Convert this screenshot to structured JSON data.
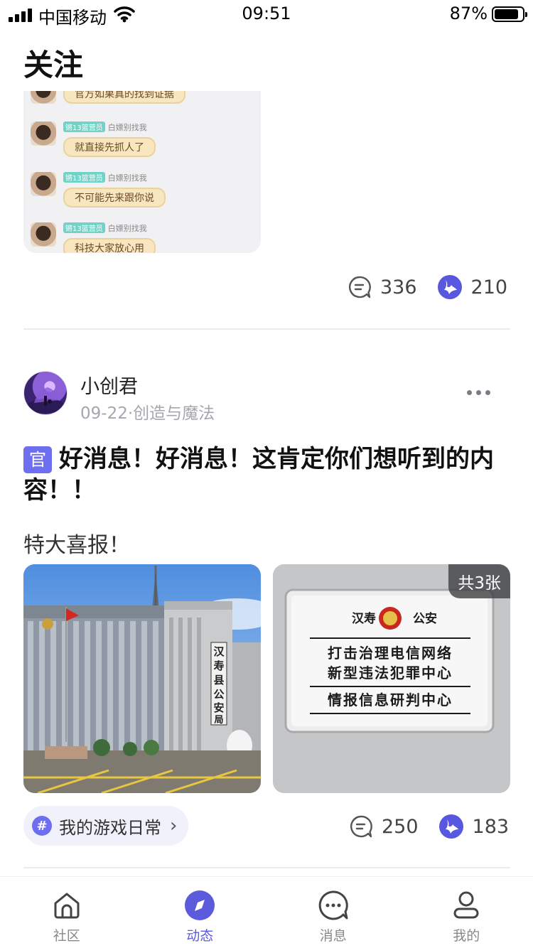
{
  "status_bar": {
    "carrier": "中国移动",
    "time": "09:51",
    "battery": "87%",
    "battery_level": 0.87,
    "signal_bars": 4
  },
  "page": {
    "title": "关注"
  },
  "post1": {
    "chat_lines": [
      {
        "meta": "",
        "tag": "",
        "text": "官方如果真的找到证据"
      },
      {
        "meta": "白嫖别找我",
        "tag": "锵13篮营员",
        "text": "就直接先抓人了"
      },
      {
        "meta": "白嫖别找我",
        "tag": "锵13篮营员",
        "text": "不可能先来跟你说"
      },
      {
        "meta": "白嫖别找我",
        "tag": "锵13篮营员",
        "text": "科技大家放心用"
      }
    ],
    "comments": "336",
    "likes": "210"
  },
  "post2": {
    "author": "小创君",
    "date": "09-22",
    "separator": "·",
    "category": "创造与魔法",
    "badge": "官",
    "title": "好消息！好消息！这肯定你们想听到的内容！！",
    "text": "特大喜报！",
    "building_sign": [
      "汉",
      "寿",
      "县",
      "公",
      "安",
      "局"
    ],
    "sign_header_left": "汉寿",
    "sign_header_right": "公安",
    "sign_lines": [
      "打击治理电信网络",
      "新型违法犯罪中心",
      "情报信息研判中心"
    ],
    "photo_count": "共3张",
    "topic": "我的游戏日常",
    "topic_hash": "#",
    "topic_arrow": "›",
    "comments": "250",
    "likes": "183"
  },
  "tabs": [
    {
      "label": "社区",
      "icon": "home-icon",
      "active": false
    },
    {
      "label": "动态",
      "icon": "compass-icon",
      "active": true
    },
    {
      "label": "消息",
      "icon": "chat-bubble-icon",
      "active": false
    },
    {
      "label": "我的",
      "icon": "profile-icon",
      "active": false
    }
  ],
  "colors": {
    "accent": "#6e6ef0",
    "active_tab": "#5b5bdc",
    "muted_text": "#a6a6ad",
    "divider": "#ececee"
  }
}
